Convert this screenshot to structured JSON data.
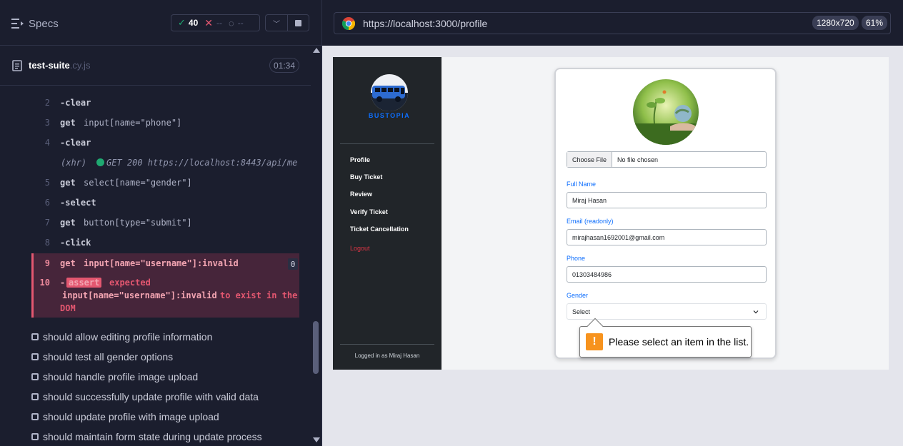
{
  "runner": {
    "specs_label": "Specs",
    "stats": {
      "passed": "40",
      "failed": "--",
      "pending": "--"
    },
    "file": {
      "name": "test-suite",
      "ext": ".cy.js",
      "duration": "01:34"
    },
    "commands": [
      {
        "num": "2",
        "name": "-clear",
        "msg": ""
      },
      {
        "num": "3",
        "name": "get",
        "msg": "input[name=\"phone\"]"
      },
      {
        "num": "4",
        "name": "-clear",
        "msg": ""
      },
      {
        "num": "5",
        "name": "get",
        "msg": "select[name=\"gender\"]"
      },
      {
        "num": "6",
        "name": "-select",
        "msg": ""
      },
      {
        "num": "7",
        "name": "get",
        "msg": "button[type=\"submit\"]"
      },
      {
        "num": "8",
        "name": "-click",
        "msg": ""
      }
    ],
    "xhr": {
      "tag": "(xhr)",
      "request": "GET 200 https://localhost:8443/api/me"
    },
    "failed": {
      "cmd9_num": "9",
      "cmd9_name": "get",
      "cmd9_msg": "input[name=\"username\"]:invalid",
      "cmd9_count": "0",
      "cmd10_num": "10",
      "cmd10_prefix": "-",
      "cmd10_badge": "assert",
      "cmd10_expected": "expected",
      "cmd10_selector": "input[name=\"username\"]:invalid",
      "cmd10_tail": "to exist in the",
      "cmd10_dom": "DOM"
    },
    "tests": [
      "should allow editing profile information",
      "should test all gender options",
      "should handle profile image upload",
      "should successfully update profile with valid data",
      "should update profile with image upload",
      "should maintain form state during update process"
    ]
  },
  "preview": {
    "url": "https://localhost:3000/profile",
    "viewport": "1280x720",
    "zoom": "61%"
  },
  "app": {
    "logo_text": "BUSTOPIA",
    "nav": [
      "Profile",
      "Buy Ticket",
      "Review",
      "Verify Ticket",
      "Ticket Cancellation"
    ],
    "logout": "Logout",
    "logged_in": "Logged in as Miraj Hasan",
    "form": {
      "choose_file": "Choose File",
      "no_file": "No file chosen",
      "full_name_label": "Full Name",
      "full_name": "Miraj Hasan",
      "email_label": "Email (readonly)",
      "email": "mirajhasan1692001@gmail.com",
      "phone_label": "Phone",
      "phone": "01303484986",
      "gender_label": "Gender",
      "gender": "Select"
    },
    "tooltip": "Please select an item in the list."
  },
  "colors": {
    "pass": "#1fa971",
    "fail": "#e45770",
    "accent": "#0d6efd",
    "warning": "#f7931e"
  }
}
